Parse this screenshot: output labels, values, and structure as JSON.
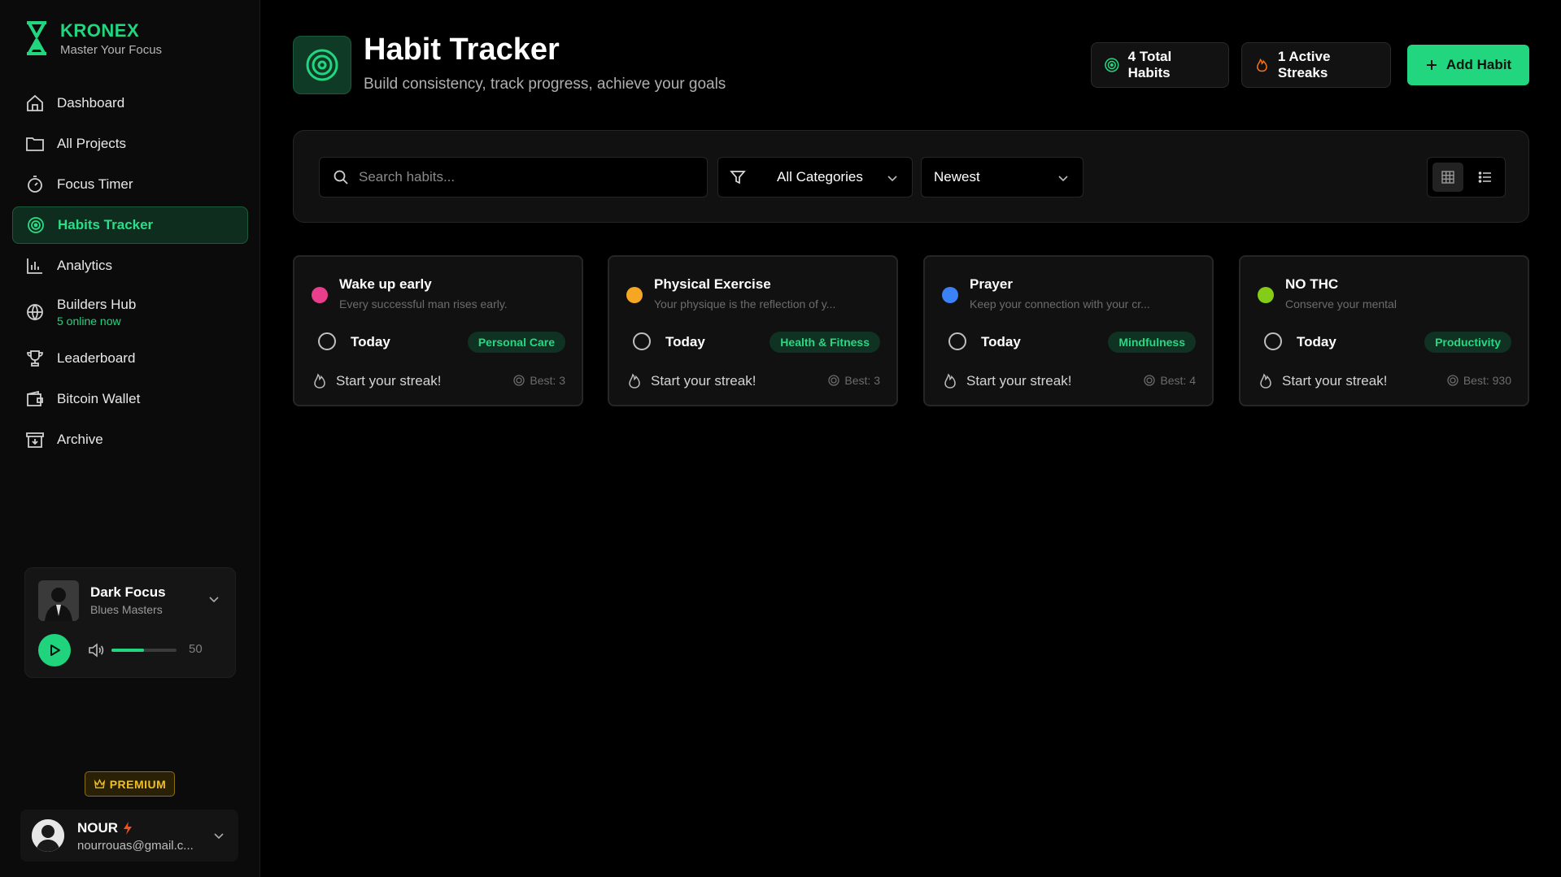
{
  "brand": {
    "name": "KRONEX",
    "tagline": "Master Your Focus"
  },
  "sidebar": {
    "items": [
      {
        "label": "Dashboard",
        "icon": "home-icon"
      },
      {
        "label": "All Projects",
        "icon": "folder-icon"
      },
      {
        "label": "Focus Timer",
        "icon": "timer-icon"
      },
      {
        "label": "Habits Tracker",
        "icon": "target-icon",
        "active": true
      },
      {
        "label": "Analytics",
        "icon": "bar-chart-icon"
      },
      {
        "label": "Builders Hub",
        "icon": "globe-icon",
        "sub": "5 online now"
      },
      {
        "label": "Leaderboard",
        "icon": "trophy-icon"
      },
      {
        "label": "Bitcoin Wallet",
        "icon": "wallet-icon"
      },
      {
        "label": "Archive",
        "icon": "archive-icon"
      }
    ]
  },
  "player": {
    "title": "Dark Focus",
    "artist": "Blues Masters",
    "volume": 50,
    "volume_fraction": 0.5
  },
  "premium": {
    "label": "PREMIUM"
  },
  "user": {
    "name": "NOUR",
    "email": "nourrouas@gmail.c..."
  },
  "header": {
    "title": "Habit Tracker",
    "subtitle": "Build consistency, track progress, achieve your goals",
    "total_habits": "4 Total Habits",
    "active_streaks": "1 Active Streaks",
    "add_label": "Add Habit"
  },
  "toolbar": {
    "search_placeholder": "Search habits...",
    "category": "All Categories",
    "sort": "Newest"
  },
  "habits": [
    {
      "title": "Wake up early",
      "desc": "Every successful man rises early.",
      "color": "#e83e8c",
      "today": "Today",
      "category": "Personal Care",
      "streak": "Start your streak!",
      "best": "Best: 3"
    },
    {
      "title": "Physical Exercise",
      "desc": "Your physique is the reflection of y...",
      "color": "#f5a623",
      "today": "Today",
      "category": "Health & Fitness",
      "streak": "Start your streak!",
      "best": "Best: 3"
    },
    {
      "title": "Prayer",
      "desc": "Keep your connection with your cr...",
      "color": "#3b82f6",
      "today": "Today",
      "category": "Mindfulness",
      "streak": "Start your streak!",
      "best": "Best: 4"
    },
    {
      "title": "NO THC",
      "desc": "Conserve your mental",
      "color": "#84cc16",
      "today": "Today",
      "category": "Productivity",
      "streak": "Start your streak!",
      "best": "Best: 930"
    }
  ],
  "colors": {
    "accent": "#22d67f",
    "background": "#000000",
    "sidebar": "#0b0b0b",
    "premium": "#f0c020"
  }
}
